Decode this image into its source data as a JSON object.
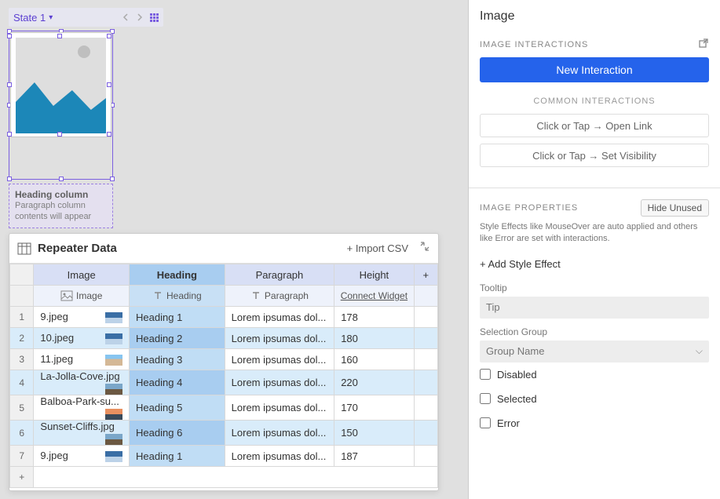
{
  "state": {
    "label": "State 1"
  },
  "textBlock": {
    "heading": "Heading column",
    "paragraph": "Paragraph column contents will appear"
  },
  "dataPanel": {
    "title": "Repeater Data",
    "importLabel": "Import CSV",
    "columns": {
      "image": "Image",
      "heading": "Heading",
      "paragraph": "Paragraph",
      "height": "Height",
      "subImage": "Image",
      "subHeading": "Heading",
      "subParagraph": "Paragraph",
      "connect": "Connect Widget"
    },
    "rows": [
      {
        "n": "1",
        "img": "9.jpeg",
        "th": "sky",
        "heading": "Heading 1",
        "para": "Lorem ipsumas dol...",
        "height": "178",
        "sel": false
      },
      {
        "n": "2",
        "img": "10.jpeg",
        "th": "sky",
        "heading": "Heading 2",
        "para": "Lorem ipsumas dol...",
        "height": "180",
        "sel": true
      },
      {
        "n": "3",
        "img": "11.jpeg",
        "th": "beach",
        "heading": "Heading 3",
        "para": "Lorem ipsumas dol...",
        "height": "160",
        "sel": false
      },
      {
        "n": "4",
        "img": "La-Jolla-Cove.jpg",
        "th": "cliff",
        "heading": "Heading 4",
        "para": "Lorem ipsumas dol...",
        "height": "220",
        "sel": true
      },
      {
        "n": "5",
        "img": "Balboa-Park-su...",
        "th": "sunset",
        "heading": "Heading 5",
        "para": "Lorem ipsumas dol...",
        "height": "170",
        "sel": false
      },
      {
        "n": "6",
        "img": "Sunset-Cliffs.jpg",
        "th": "cliff",
        "heading": "Heading 6",
        "para": "Lorem ipsumas dol...",
        "height": "150",
        "sel": true
      },
      {
        "n": "7",
        "img": "9.jpeg",
        "th": "sky",
        "heading": "Heading 1",
        "para": "Lorem ipsumas dol...",
        "height": "187",
        "sel": false
      }
    ]
  },
  "right": {
    "title": "Image",
    "interactionsHead": "IMAGE INTERACTIONS",
    "newInteraction": "New Interaction",
    "commonHead": "COMMON INTERACTIONS",
    "common1": "Click or Tap → Open Link",
    "common2": "Click or Tap → Set Visibility",
    "propsHead": "IMAGE PROPERTIES",
    "hideUnused": "Hide Unused",
    "propsDesc": "Style Effects like MouseOver are auto applied and others like Error are set with interactions.",
    "addStyle": "+ Add Style Effect",
    "tooltipLabel": "Tooltip",
    "tooltipPlaceholder": "Tip",
    "selGroupLabel": "Selection Group",
    "selGroupPlaceholder": "Group Name",
    "disabled": "Disabled",
    "selected": "Selected",
    "error": "Error"
  }
}
